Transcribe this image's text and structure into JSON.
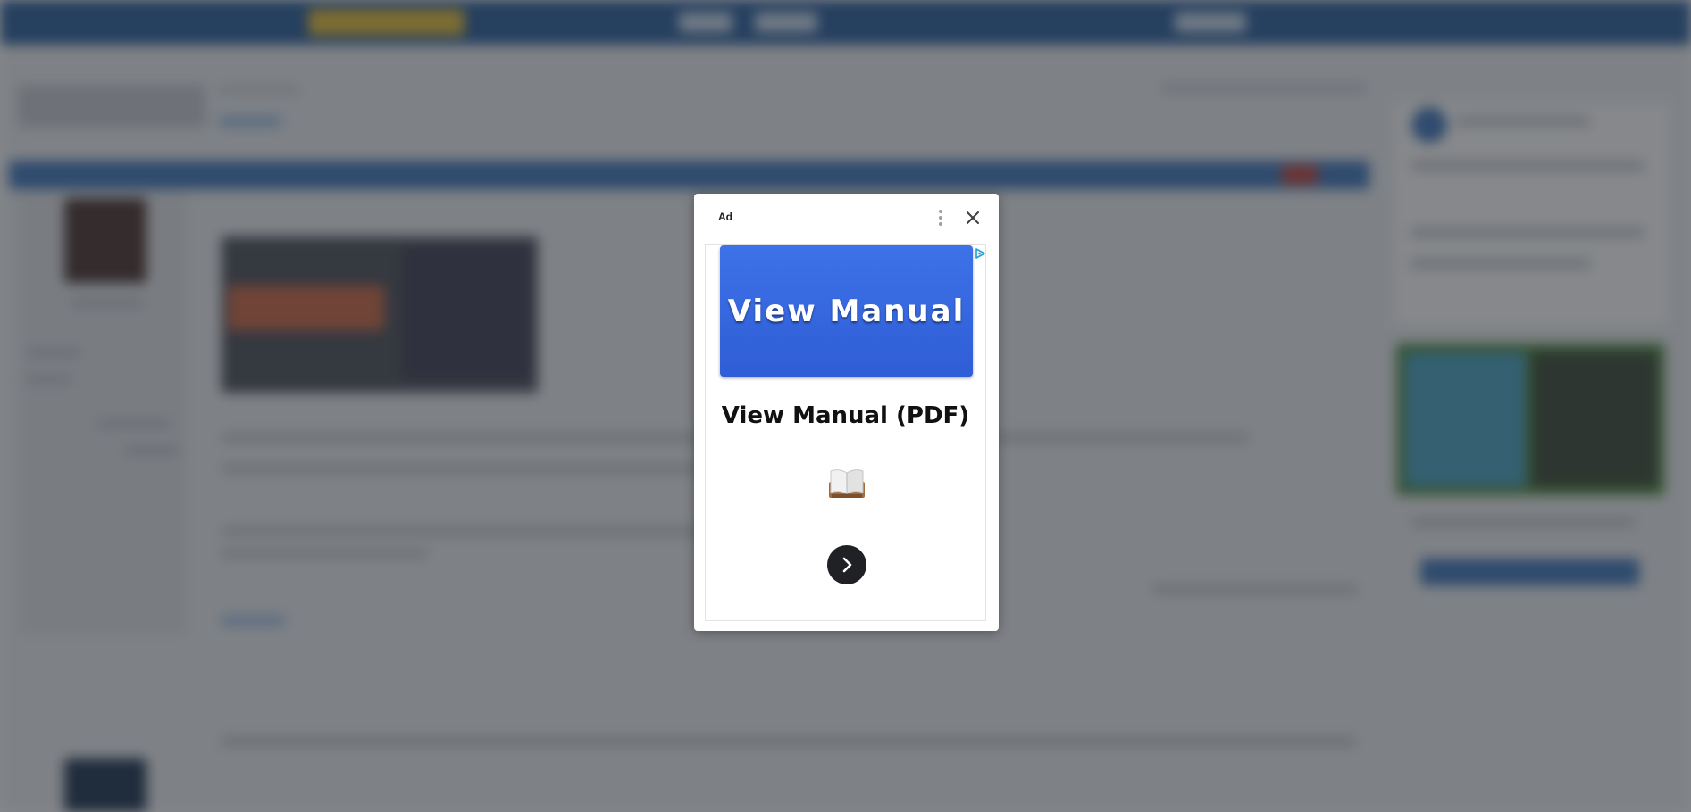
{
  "ad": {
    "label": "Ad",
    "banner_text": "View Manual",
    "headline": "View Manual (PDF)",
    "icons": {
      "menu": "more-vertical-icon",
      "close": "close-icon",
      "adchoices": "adchoices-icon",
      "book": "open-book-icon",
      "next": "chevron-right-icon"
    },
    "colors": {
      "banner": "#3466e0",
      "next_button": "#202124",
      "adchoices": "#1fa0d9"
    }
  }
}
